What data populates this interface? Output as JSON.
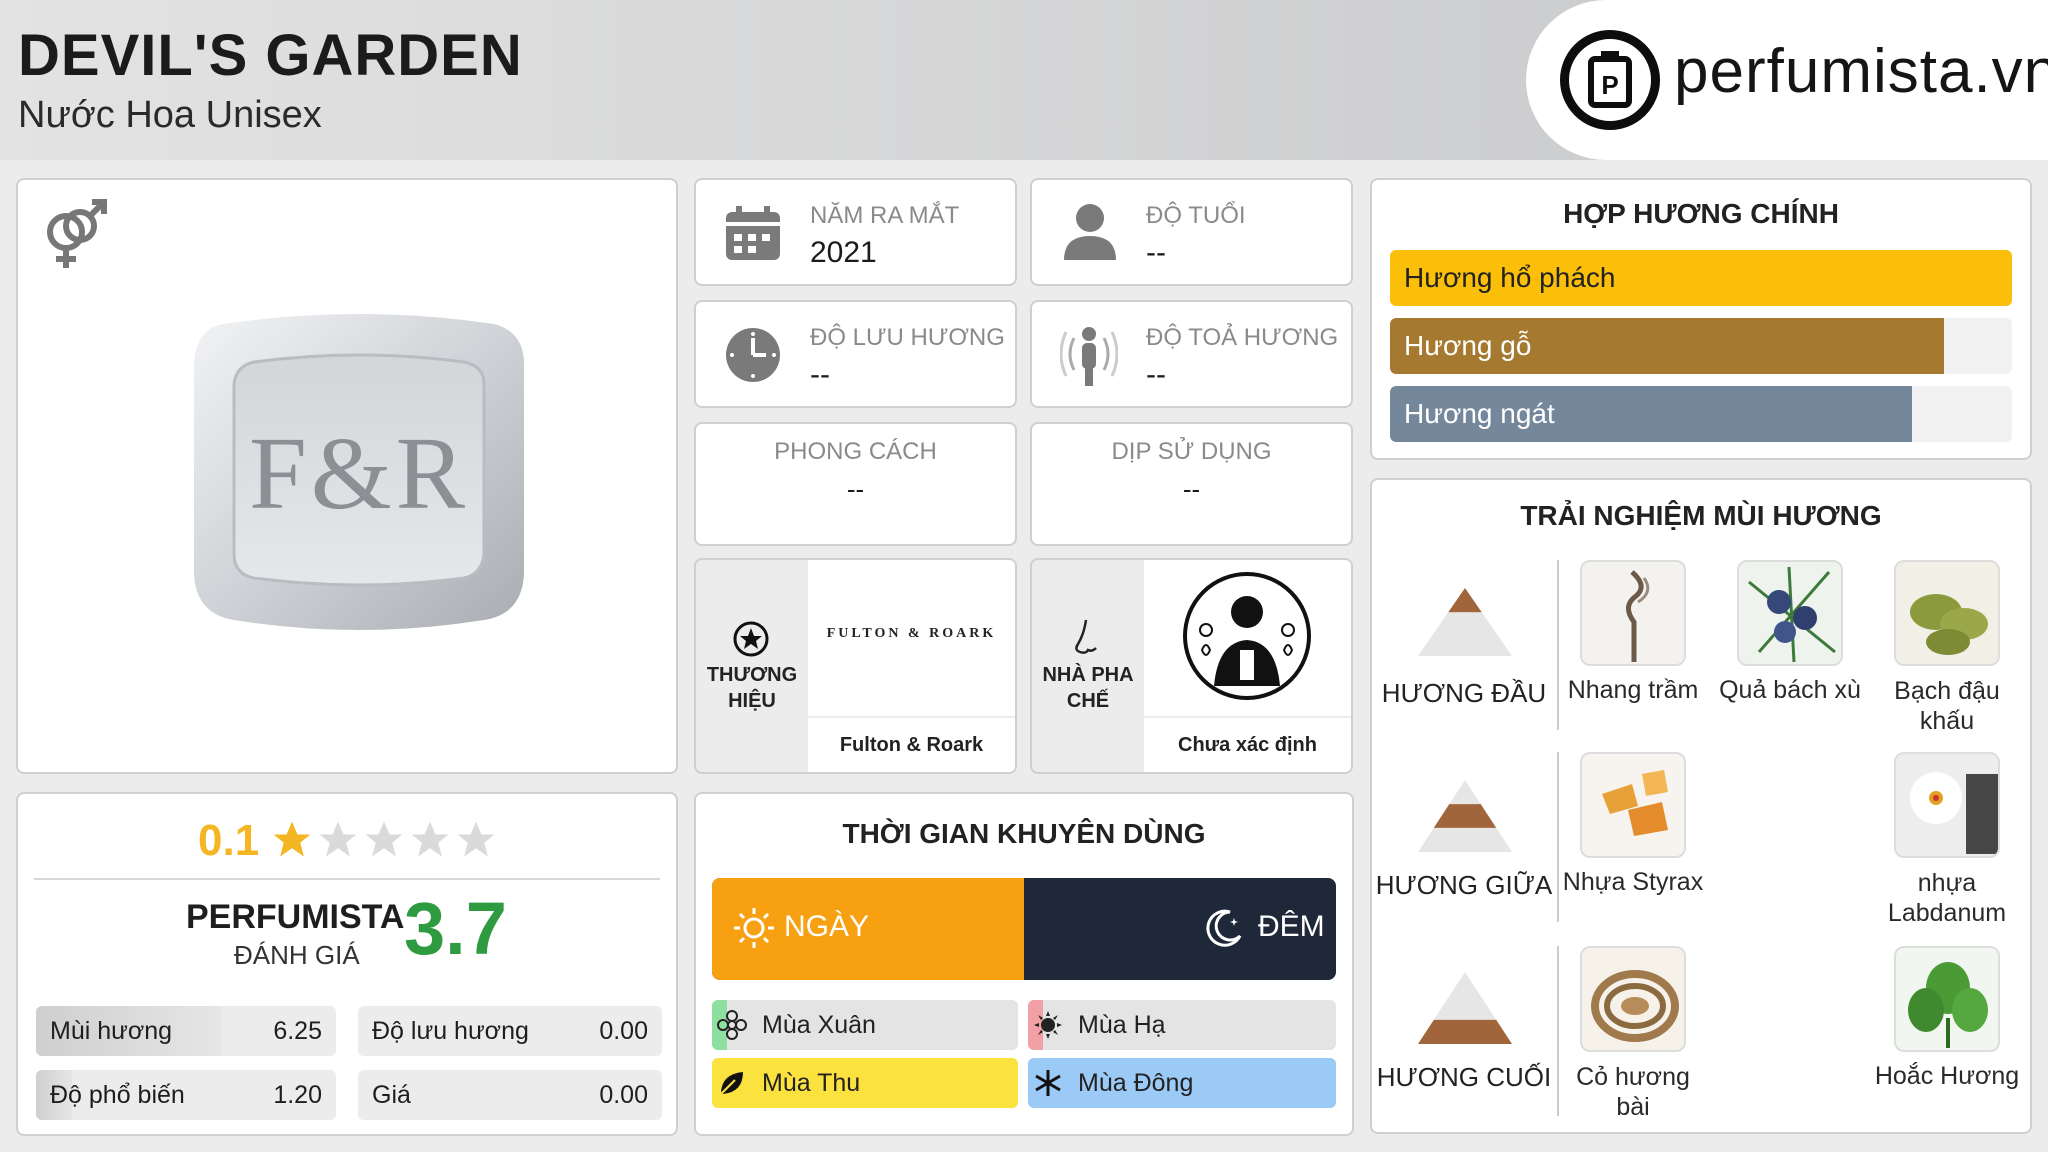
{
  "header": {
    "title": "DEVIL'S GARDEN",
    "subtitle": "Nước Hoa Unisex",
    "logo_text": "perfumista.vn",
    "logo_mark": "P"
  },
  "product": {
    "gender_icon": "unisex-gender-icon",
    "image_icon": "fr-logo-bottle-cap",
    "brand_mark": "F&R"
  },
  "info": {
    "release_label": "NĂM RA MẮT",
    "release_value": "2021",
    "age_label": "ĐỘ TUỔI",
    "age_value": "--",
    "longevity_label": "ĐỘ LƯU HƯƠNG",
    "longevity_value": "--",
    "sillage_label": "ĐỘ TOẢ HƯƠNG",
    "sillage_value": "--",
    "style_label": "PHONG CÁCH",
    "style_value": "--",
    "occasion_label": "DỊP SỬ DỤNG",
    "occasion_value": "--",
    "brand_label_1": "THƯƠNG",
    "brand_label_2": "HIỆU",
    "brand_logo_text": "FULTON & ROARK",
    "brand_name": "Fulton & Roark",
    "perfumer_label_1": "NHÀ PHA",
    "perfumer_label_2": "CHẾ",
    "perfumer_name": "Chưa xác định"
  },
  "accords": {
    "title": "HỢP HƯƠNG CHÍNH",
    "items": [
      {
        "label": "Hương hổ phách",
        "percent": 100,
        "color": "#fbbf09",
        "text_color": "#222222"
      },
      {
        "label": "Hương gỗ",
        "percent": 89,
        "color": "#a5792f",
        "text_color": "#ffffff"
      },
      {
        "label": "Hương ngát",
        "percent": 84,
        "color": "#74879b",
        "text_color": "#ffffff"
      }
    ]
  },
  "experience": {
    "title": "TRẢI NGHIỆM MÙI HƯƠNG",
    "top_label": "HƯƠNG ĐẦU",
    "heart_label": "HƯƠNG GIỮA",
    "base_label": "HƯƠNG CUỐI",
    "top_notes": [
      "Nhang trầm",
      "Quả bách xù",
      "Bạch đậu khấu"
    ],
    "heart_notes": [
      "Nhựa Styrax",
      "nhựa Labdanum"
    ],
    "base_notes": [
      "Cỏ hương bài",
      "Hoắc Hương"
    ]
  },
  "rating": {
    "user_score": "0.1",
    "stars_filled": 0.02,
    "stars_total": 5,
    "perfumista_label": "PERFUMISTA",
    "rating_label": "ĐÁNH GIÁ",
    "perfumista_score": "3.7",
    "metrics": [
      {
        "label": "Mùi hương",
        "value": "6.25",
        "fill": 0.62
      },
      {
        "label": "Độ lưu hương",
        "value": "0.00",
        "fill": 0
      },
      {
        "label": "Độ phổ biến",
        "value": "1.20",
        "fill": 0.12
      },
      {
        "label": "Giá",
        "value": "0.00",
        "fill": 0
      }
    ]
  },
  "time": {
    "title": "THỜI GIAN KHUYÊN DÙNG",
    "day_label": "NGÀY",
    "night_label": "ĐÊM",
    "day_percent": 50,
    "spring": "Mùa Xuân",
    "summer": "Mùa Hạ",
    "autumn": "Mùa Thu",
    "winter": "Mùa Đông",
    "spring_level": 0.05,
    "summer_level": 0.05,
    "autumn_level": 1,
    "winter_level": 1
  }
}
